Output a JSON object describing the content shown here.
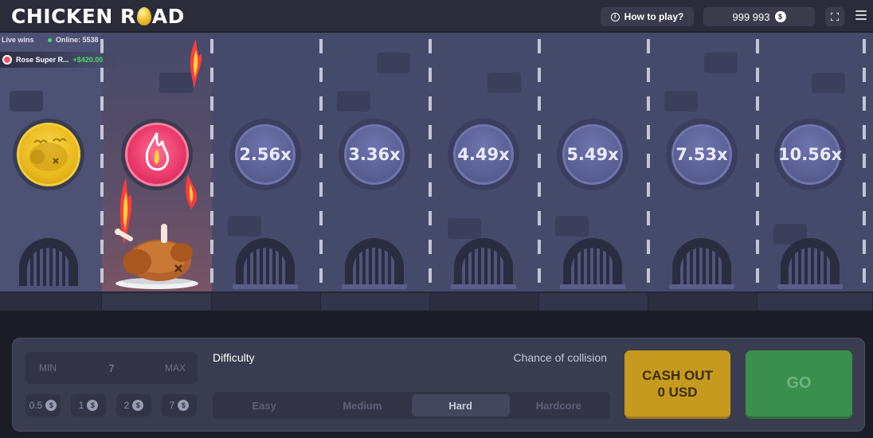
{
  "header": {
    "logo_left": "CHICKEN R",
    "logo_right": "AD",
    "how_to_play": "How to play?",
    "balance": "999 993",
    "currency_symbol": "$"
  },
  "live": {
    "title": "Live wins",
    "online": "Online: 5538",
    "recent_win": {
      "name": "Rose Super R...",
      "amount": "+$420.00"
    }
  },
  "multipliers": [
    "2.56x",
    "3.36x",
    "4.49x",
    "5.49x",
    "7.53x",
    "10.56x"
  ],
  "bet": {
    "min_label": "MIN",
    "value": "7",
    "max_label": "MAX",
    "chips": [
      "0.5",
      "1",
      "2",
      "7"
    ],
    "chip_symbol": "$"
  },
  "difficulty": {
    "label": "Difficulty",
    "chance_label": "Chance of collision",
    "options": [
      "Easy",
      "Medium",
      "Hard",
      "Hardcore"
    ],
    "selected": "Hard"
  },
  "cashout": {
    "line1": "CASH OUT",
    "line2": "0 USD"
  },
  "go": "GO",
  "colors": {
    "accent_gold": "#c69a1e",
    "go_green": "#3a8e4e",
    "lane_bg": "#464a6a",
    "win_green": "#4cd964",
    "hit_pink": "#e8386a"
  }
}
